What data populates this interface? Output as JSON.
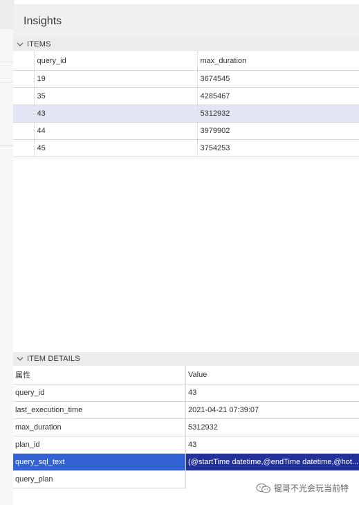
{
  "panel": {
    "title": "Insights"
  },
  "items": {
    "section_label": "ITEMS",
    "columns": [
      "query_id",
      "max_duration"
    ],
    "rows": [
      {
        "query_id": "19",
        "max_duration": "3674545"
      },
      {
        "query_id": "35",
        "max_duration": "4285467"
      },
      {
        "query_id": "43",
        "max_duration": "5312932",
        "selected": true
      },
      {
        "query_id": "44",
        "max_duration": "3979902"
      },
      {
        "query_id": "45",
        "max_duration": "3754253"
      }
    ]
  },
  "details": {
    "section_label": "ITEM DETAILS",
    "columns": [
      "属性",
      "Value"
    ],
    "rows": [
      {
        "prop": "query_id",
        "value": "43"
      },
      {
        "prop": "last_execution_time",
        "value": "2021-04-21 07:39:07"
      },
      {
        "prop": "max_duration",
        "value": "5312932"
      },
      {
        "prop": "plan_id",
        "value": "43"
      },
      {
        "prop": "query_sql_text",
        "value": "(@startTime datetime,@endTime datetime,@hot...",
        "selected": true
      },
      {
        "prop": "query_plan",
        "value": ""
      }
    ]
  },
  "watermark": {
    "text": "锟哥不光会玩当前特",
    "icon": "wechat-icon"
  },
  "colors": {
    "selected_row": "#e2e5f4",
    "selected_prop": "#3361d6",
    "selected_value": "#23329a",
    "header_bg": "#f0f0f0"
  }
}
